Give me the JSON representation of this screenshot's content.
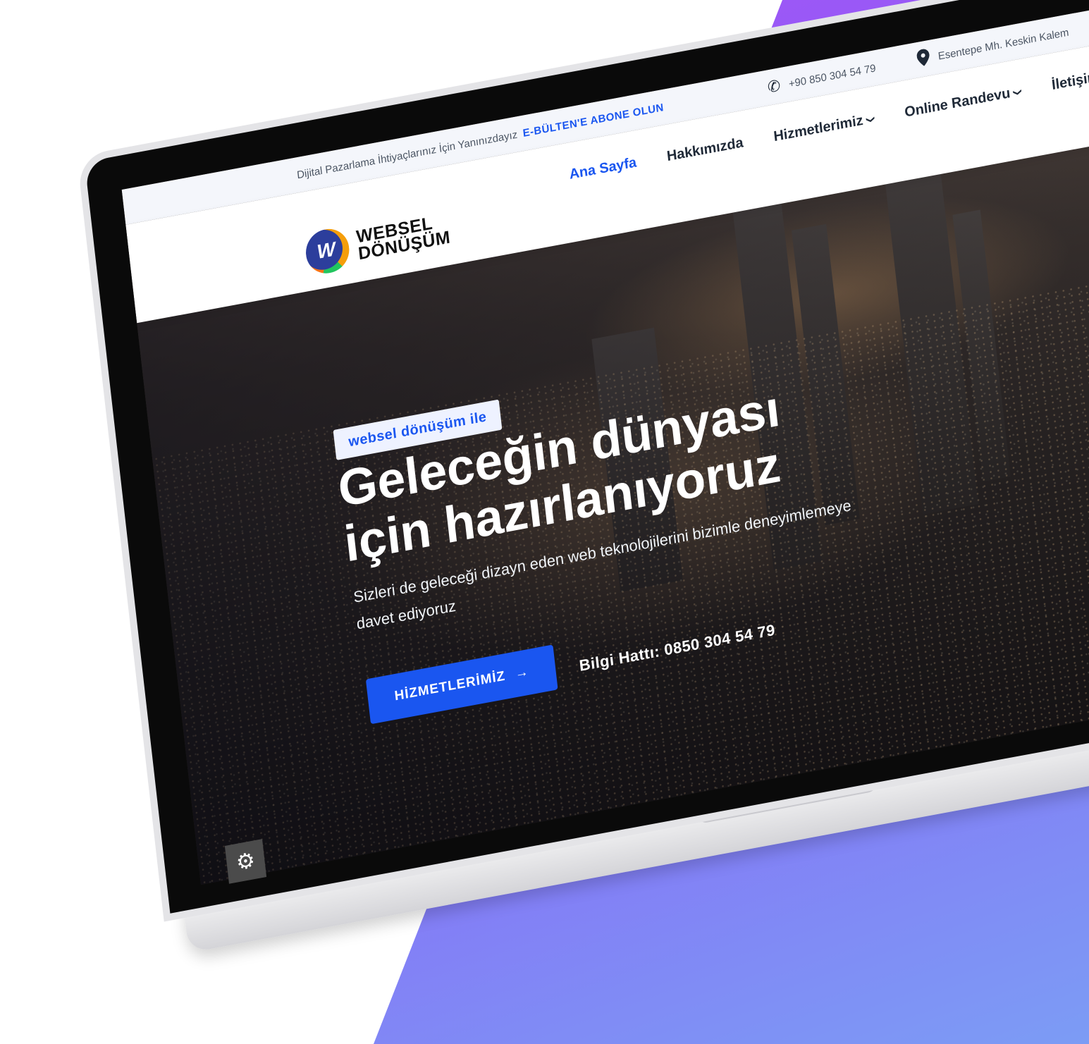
{
  "topbar": {
    "tagline": "Dijital Pazarlama İhtiyaçlarınız İçin Yanınızdayız",
    "subscribe_link": "E-BÜLTEN'E ABONE OLUN",
    "phone": "+90 850 304 54 79",
    "address": "Esentepe Mh. Keskin Kalem"
  },
  "brand": {
    "line1": "WEBSEL",
    "line2": "DÖNÜŞÜM"
  },
  "nav": {
    "items": [
      {
        "label": "Ana Sayfa",
        "active": true,
        "dropdown": false
      },
      {
        "label": "Hakkımızda",
        "active": false,
        "dropdown": false
      },
      {
        "label": "Hizmetlerimiz",
        "active": false,
        "dropdown": true
      },
      {
        "label": "Online Randevu",
        "active": false,
        "dropdown": true
      },
      {
        "label": "İletişim",
        "active": false,
        "dropdown": true
      }
    ]
  },
  "hero": {
    "badge": "websel dönüşüm ile",
    "headline_line1": "Geleceğin dünyası",
    "headline_line2": "için hazırlanıyoruz",
    "lead": "Sizleri de geleceği dizayn eden web teknolojilerini bizimle deneyimlemeye davet ediyoruz",
    "cta_label": "HİZMETLERİMİZ",
    "hotline": "Bilgi Hattı: 0850 304 54 79"
  },
  "colors": {
    "accent": "#1a56f0",
    "backdrop_gradient": [
      "#a855f7",
      "#7c9cf5"
    ]
  },
  "icons": {
    "phone": "phone-icon",
    "address": "map-pin-icon",
    "cta_arrow": "arrow-right-icon",
    "settings": "gear-icon",
    "dropdown": "chevron-down-icon"
  }
}
